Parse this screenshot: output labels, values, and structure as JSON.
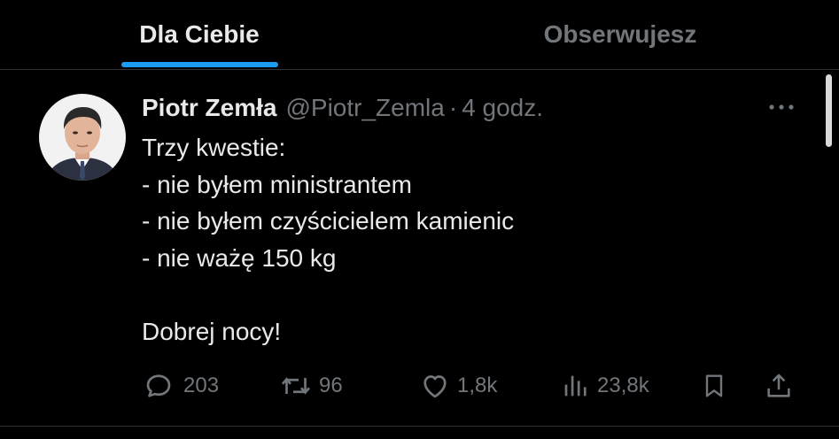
{
  "tabs": [
    {
      "label": "Dla Ciebie",
      "active": true
    },
    {
      "label": "Obserwujesz",
      "active": false
    }
  ],
  "tweet": {
    "author_name": "Piotr Zemła",
    "author_handle": "@Piotr_Zemla",
    "separator": "·",
    "timestamp": "4 godz.",
    "lines": [
      "Trzy kwestie:",
      "- nie byłem ministrantem",
      "- nie byłem czyścicielem kamienic",
      "- nie ważę 150 kg",
      "",
      "Dobrej nocy!"
    ],
    "stats": {
      "replies": "203",
      "retweets": "96",
      "likes": "1,8k",
      "views": "23,8k"
    }
  },
  "colors": {
    "background": "#000000",
    "text_primary": "#e7e9ea",
    "text_secondary": "#71767b",
    "accent": "#1d9bf0",
    "divider": "#2f3336"
  },
  "icons": {
    "more": "more-dots-icon",
    "reply": "reply-bubble-icon",
    "retweet": "retweet-icon",
    "like": "heart-icon",
    "views": "bar-chart-icon",
    "bookmark": "bookmark-icon",
    "share": "share-upload-icon"
  }
}
